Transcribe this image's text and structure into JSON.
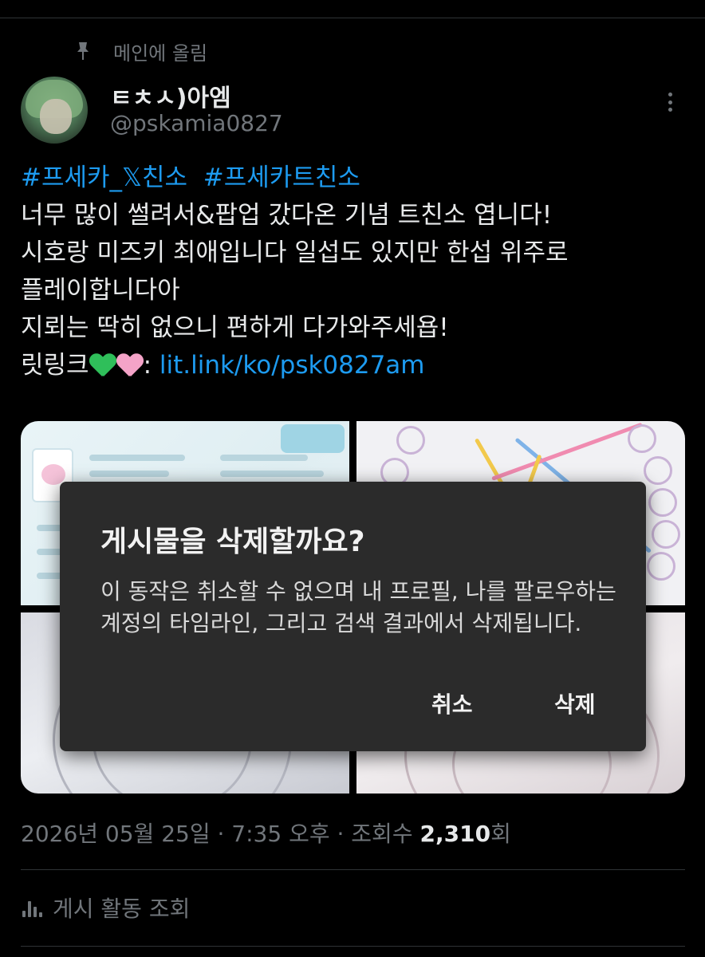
{
  "pinned_label": "메인에 올림",
  "author": {
    "display_name": "ㅌㅊㅅ)아엠",
    "handle": "@pskamia0827"
  },
  "tweet": {
    "hashtag_1": "#프세카_𝕏친소",
    "hashtag_2": "#프세카트친소",
    "line_2": "너무 많이 썰려서&팝업 갔다온 기념 트친소 엽니다!",
    "line_3": "시호랑 미즈키 최애입니다 일섭도 있지만 한섭 위주로",
    "line_4": "플레이합니다아",
    "line_5": "지뢰는 딱히 없으니 편하게 다가와주세욥!",
    "line_6_prefix": "릿링크",
    "line_6_colon": ": ",
    "link": "lit.link/ko/psk0827am"
  },
  "dialog": {
    "title": "게시물을 삭제할까요?",
    "body": "이 동작은 취소할 수 없으며 내 프로필, 나를 팔로우하는 계정의 타임라인, 그리고 검색 결과에서 삭제됩니다.",
    "cancel_label": "취소",
    "delete_label": "삭제"
  },
  "meta": {
    "timestamp": "2026년 05월 25일 · 7:35 오후 · 조회수 ",
    "views": "2,310",
    "views_suffix": "회"
  },
  "activity_label": "게시 활동 조회",
  "colors": {
    "background": "#000000",
    "accent": "#1d9bf0",
    "secondary_text": "#71767b",
    "dialog_bg": "#2b2b2b"
  },
  "icons": {
    "pin": "pin-icon",
    "more": "more-vertical-icon",
    "activity": "bar-chart-icon",
    "heart_green": "green-heart-emoji",
    "heart_pink": "pink-heart-emoji"
  }
}
